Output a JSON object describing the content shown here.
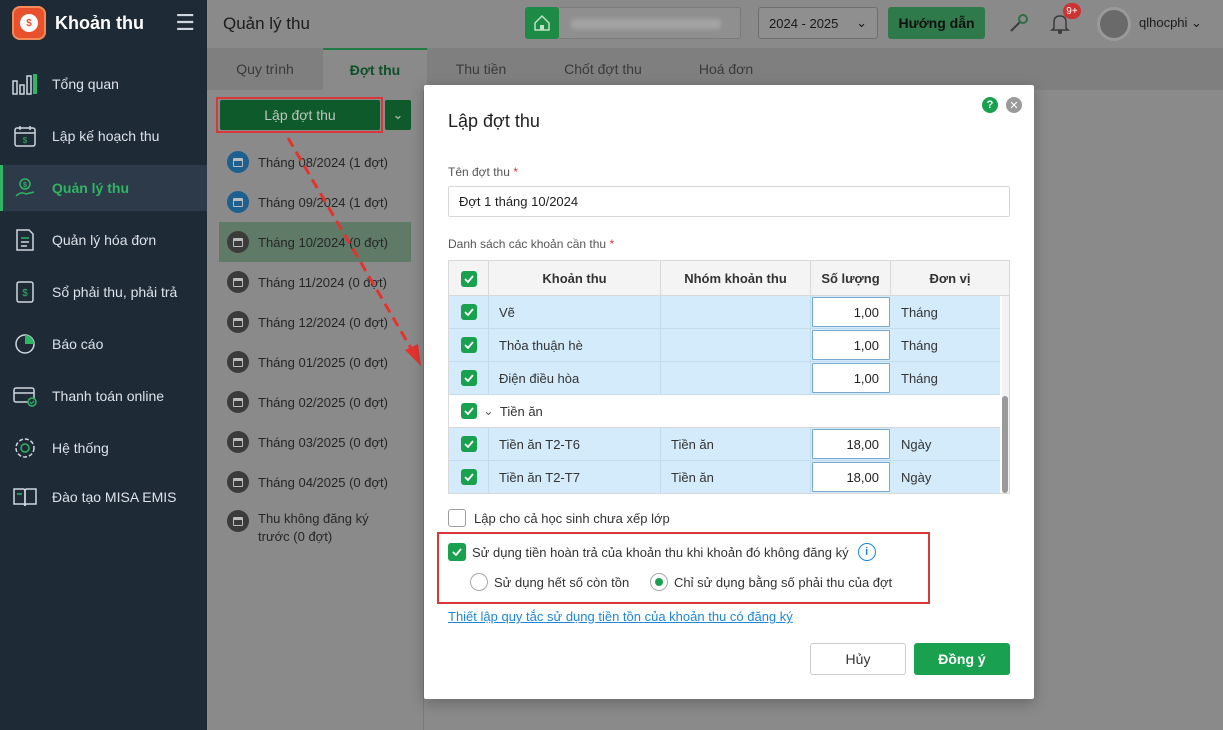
{
  "app": {
    "name": "Khoản thu"
  },
  "sidebar": {
    "items": [
      {
        "label": "Tổng quan",
        "icon": "bar-chart-icon"
      },
      {
        "label": "Lập kế hoạch thu",
        "icon": "calendar-icon"
      },
      {
        "label": "Quản lý thu",
        "icon": "money-hand-icon",
        "active": true
      },
      {
        "label": "Quản lý hóa đơn",
        "icon": "invoice-icon"
      },
      {
        "label": "Sổ phải thu, phải trả",
        "icon": "ledger-icon"
      },
      {
        "label": "Báo cáo",
        "icon": "pie-chart-icon"
      },
      {
        "label": "Thanh toán online",
        "icon": "card-check-icon"
      },
      {
        "label": "Hệ thống",
        "icon": "gear-icon"
      },
      {
        "label": "Đào tạo MISA EMIS",
        "icon": "book-icon"
      }
    ]
  },
  "header": {
    "page_title": "Quản lý thu",
    "school_year": "2024 - 2025",
    "guide_label": "Hướng dẫn",
    "notification_count": "9+",
    "username": "qlhocphi"
  },
  "tabs": [
    "Quy trình",
    "Đợt thu",
    "Thu tiền",
    "Chốt đợt thu",
    "Hoá đơn"
  ],
  "left_panel": {
    "create_label": "Lập đợt thu",
    "periods": [
      "Tháng 08/2024 (1 đợt)",
      "Tháng 09/2024 (1 đợt)",
      "Tháng 10/2024 (0 đợt)",
      "Tháng 11/2024 (0 đợt)",
      "Tháng 12/2024 (0 đợt)",
      "Tháng 01/2025 (0 đợt)",
      "Tháng 02/2025 (0 đợt)",
      "Tháng 03/2025 (0 đợt)",
      "Tháng 04/2025 (0 đợt)"
    ],
    "unregistered_line1": "Thu không đăng ký",
    "unregistered_line2": "trước (0 đợt)"
  },
  "modal": {
    "title": "Lập đợt thu",
    "name_label": "Tên đợt thu",
    "name_value": "Đợt 1 tháng 10/2024",
    "list_label": "Danh sách các khoản cần thu",
    "columns": [
      "Khoản thu",
      "Nhóm khoản thu",
      "Số lượng",
      "Đơn vị"
    ],
    "rows": [
      {
        "name": "Vẽ",
        "group": "",
        "qty": "1,00",
        "unit": "Tháng"
      },
      {
        "name": "Thỏa thuận hè",
        "group": "",
        "qty": "1,00",
        "unit": "Tháng"
      },
      {
        "name": "Điện điều hòa",
        "group": "",
        "qty": "1,00",
        "unit": "Tháng"
      },
      {
        "group_header": "Tiền ăn"
      },
      {
        "name": "Tiền ăn T2-T6",
        "group": "Tiền ăn",
        "qty": "18,00",
        "unit": "Ngày"
      },
      {
        "name": "Tiền ăn T2-T7",
        "group": "Tiền ăn",
        "qty": "18,00",
        "unit": "Ngày"
      }
    ],
    "unassigned_label": "Lập cho cả học sinh chưa xếp lớp",
    "refund_label": "Sử dụng tiền hoàn trả của khoản thu khi khoản đó không đăng ký",
    "radio_all": "Sử dụng hết số còn tồn",
    "radio_only": "Chỉ sử dụng bằng số phải thu của đợt",
    "link_text": "Thiết lập quy tắc sử dụng tiền tồn của khoản thu có đăng ký",
    "cancel_label": "Hủy",
    "ok_label": "Đồng ý"
  }
}
